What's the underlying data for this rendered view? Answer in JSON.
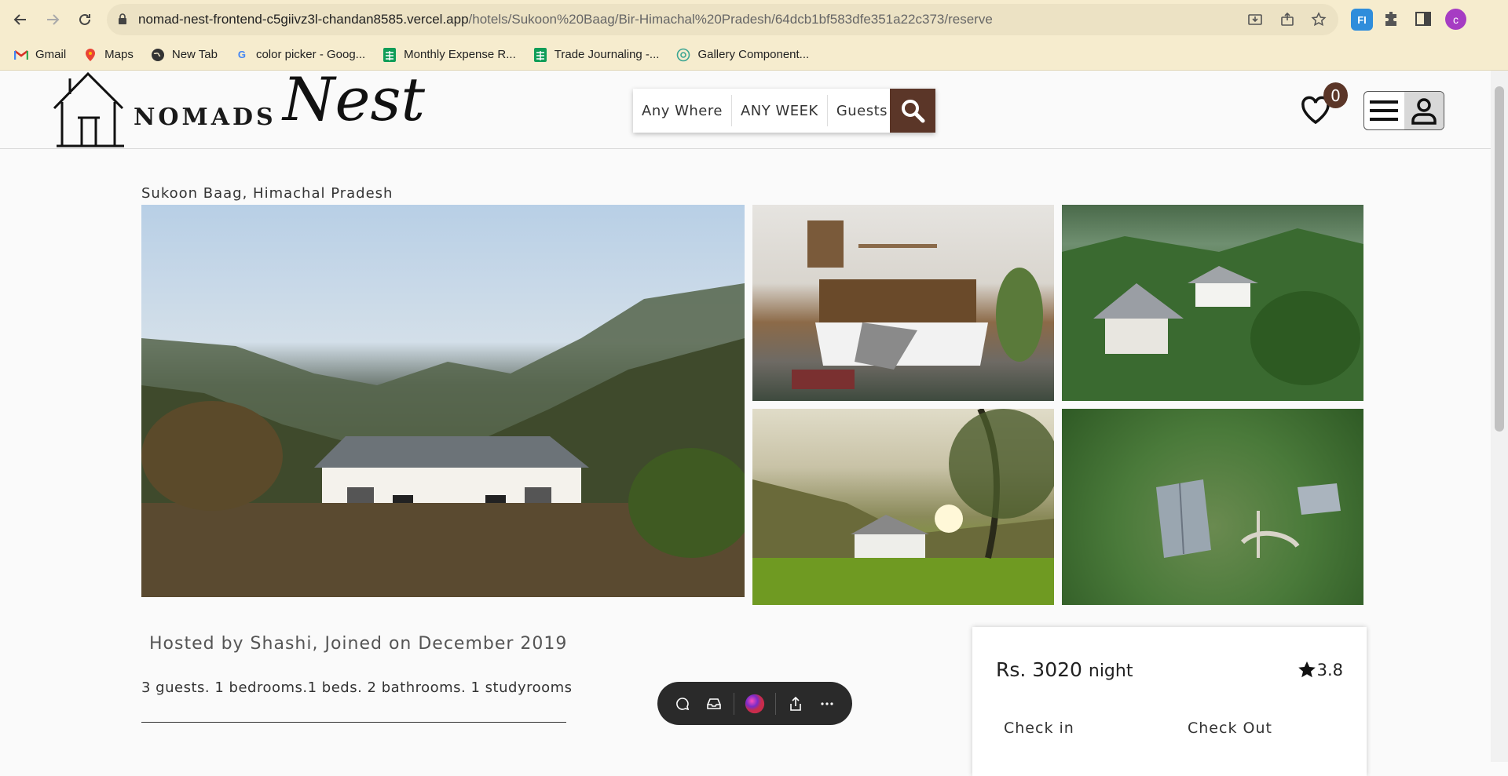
{
  "browser": {
    "url_host": "nomad-nest-frontend-c5giivz3l-chandan8585.vercel.app",
    "url_path": "/hotels/Sukoon%20Baag/Bir-Himachal%20Pradesh/64dcb1bf583dfe351a22c373/reserve",
    "profile_initial": "c",
    "bookmarks": [
      {
        "label": "Gmail",
        "icon": "gmail-icon"
      },
      {
        "label": "Maps",
        "icon": "maps-icon"
      },
      {
        "label": "New Tab",
        "icon": "globe-icon"
      },
      {
        "label": "color picker - Goog...",
        "icon": "google-icon"
      },
      {
        "label": "Monthly Expense R...",
        "icon": "sheets-icon"
      },
      {
        "label": "Trade Journaling -...",
        "icon": "sheets-icon"
      },
      {
        "label": "Gallery Component...",
        "icon": "openai-icon"
      }
    ]
  },
  "header": {
    "logo_text": "NOMADS",
    "logo_script": "Nest",
    "search": {
      "where": "Any Where",
      "week": "ANY WEEK",
      "guests": "Guests"
    },
    "wishlist_count": "0"
  },
  "hotel": {
    "location": "Sukoon Baag, Himachal Pradesh",
    "hosted_by": "Hosted by Shashi, Joined on December 2019",
    "specs": "3 guests. 1 bedrooms.1 beds. 2 bathrooms. 1 studyrooms"
  },
  "booking": {
    "price": "Rs. 3020",
    "price_unit": "night",
    "rating": "3.8",
    "check_in_label": "Check in",
    "check_out_label": "Check Out"
  },
  "colors": {
    "brand_brown": "#5b3628",
    "chrome_bg": "#f6ecce"
  }
}
